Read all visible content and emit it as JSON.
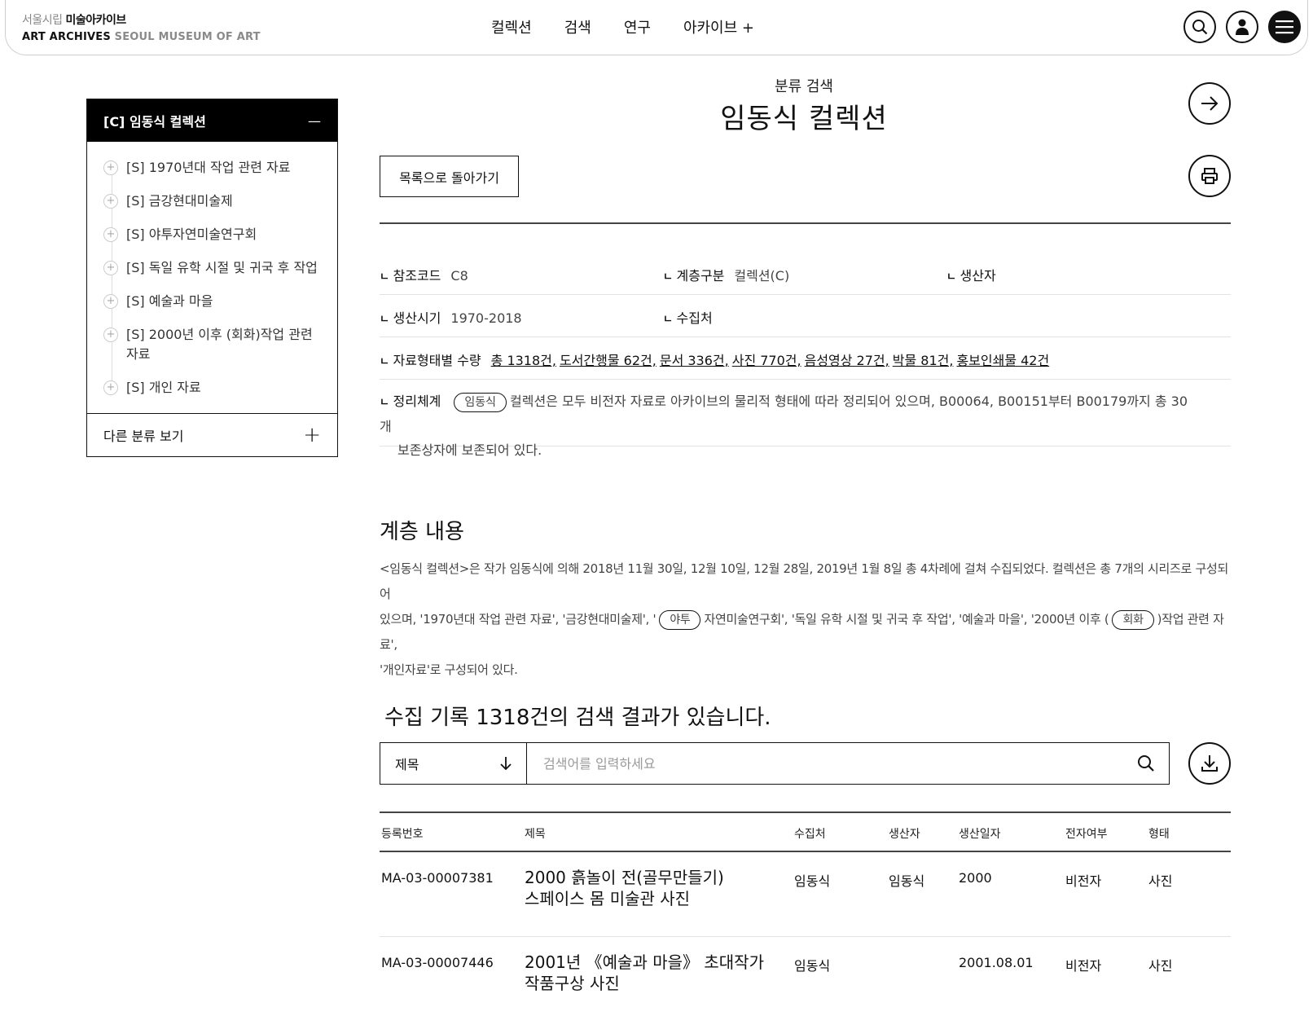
{
  "header": {
    "logo_top_plain": "서울시립 ",
    "logo_top_bold": "미술아카이브",
    "logo_bottom_bold": "ART ARCHIVES ",
    "logo_bottom_grey": "SEOUL MUSEUM OF ART",
    "nav": [
      "컬렉션",
      "검색",
      "연구",
      "아카이브 +"
    ]
  },
  "sidebar": {
    "title": "[C] 임동식 컬렉션",
    "collapse_symbol": "—",
    "items": [
      "[S] 1970년대 작업 관련 자료",
      "[S] 금강현대미술제",
      "[S] 야투자연미술연구회",
      "[S] 독일 유학 시절 및 귀국 후 작업",
      "[S] 예술과 마을",
      "[S] 2000년 이후 (회화)작업 관련 자료",
      "[S] 개인 자료"
    ],
    "footer_label": "다른 분류 보기",
    "footer_symbol": "+"
  },
  "page": {
    "subtitle": "분류 검색",
    "title": "임동식 컬렉션",
    "back_button": "목록으로 돌아가기"
  },
  "info": {
    "ref_code_label": "참조코드",
    "ref_code": "C8",
    "level_label": "계층구분",
    "level": "컬렉션(C)",
    "producer_label": "생산자",
    "period_label": "생산시기",
    "period": "1970-2018",
    "source_label": "수집처",
    "quantity_label": "자료형태별 수량",
    "quantities": [
      "총 1318건,",
      "도서간행물 62건,",
      "문서 336건,",
      "사진 770건,",
      "음성영상 27건,",
      "박물 81건,",
      "홍보인쇄물 42건"
    ],
    "arrangement_label": "정리체계",
    "arrangement_pill": "임동식",
    "arrangement_line1": "컬렉션은 모두 비전자 자료로 아카이브의 물리적 형태에 따라 정리되어 있으며, B00064, B00151부터 B00179까지 총 30개",
    "arrangement_line2": "보존상자에 보존되어 있다."
  },
  "scope": {
    "title": "계층 내용",
    "p1": "<임동식 컬렉션>은 작가 임동식에 의해 2018년 11월 30일, 12월 10일, 12월 28일, 2019년 1월 8일 총 4차례에 걸쳐 수집되었다. 컬렉션은 총 7개의 시리즈로 구성되어",
    "p2a": "있으며, '1970년대 작업 관련 자료', '금강현대미술제', '",
    "pill1": "야투",
    "p2b": "자연미술연구회', '독일 유학 시절 및 귀국 후 작업', '예술과 마을', '2000년 이후 (",
    "pill2": "회화",
    "p2c": ")작업 관련 자료',",
    "p3": "'개인자료'로 구성되어 있다."
  },
  "results": {
    "title": "수집 기록 1318건의 검색 결과가 있습니다.",
    "select_value": "제목",
    "search_placeholder": "검색어를 입력하세요",
    "columns": [
      "등록번호",
      "제목",
      "수집처",
      "생산자",
      "생산일자",
      "전자여부",
      "형태"
    ],
    "rows": [
      {
        "id": "MA-03-00007381",
        "title1": "2000 흙놀이 전(골무만들기)",
        "title2": "스페이스 몸 미술관 사진",
        "source": "임동식",
        "producer": "임동식",
        "date": "2000",
        "electronic": "비전자",
        "form": "사진"
      },
      {
        "id": "MA-03-00007446",
        "title1": "2001년 《예술과 마을》 초대작가",
        "title2": "작품구상 사진",
        "source": "임동식",
        "producer": "",
        "date": "2001.08.01",
        "electronic": "비전자",
        "form": "사진"
      }
    ]
  }
}
